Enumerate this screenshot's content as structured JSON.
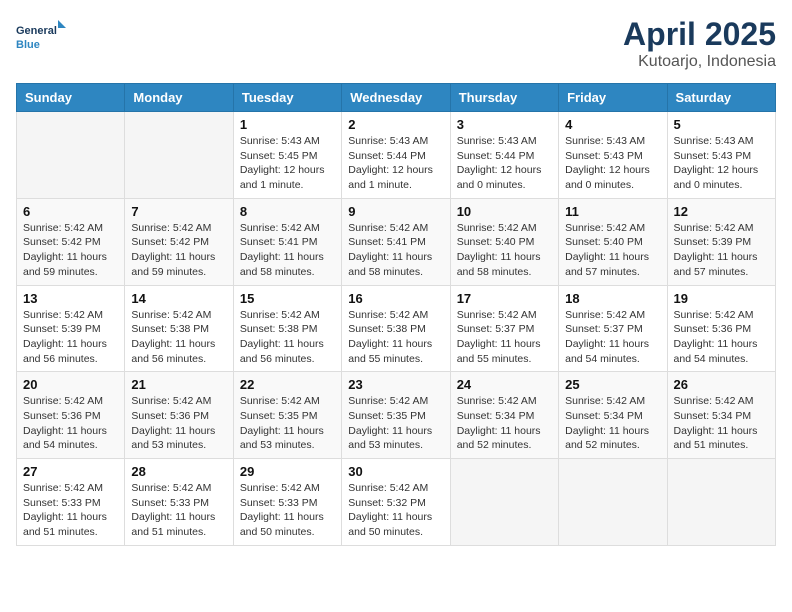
{
  "header": {
    "logo_line1": "General",
    "logo_line2": "Blue",
    "title": "April 2025",
    "subtitle": "Kutoarjo, Indonesia"
  },
  "weekdays": [
    "Sunday",
    "Monday",
    "Tuesday",
    "Wednesday",
    "Thursday",
    "Friday",
    "Saturday"
  ],
  "weeks": [
    [
      {
        "day": "",
        "info": ""
      },
      {
        "day": "",
        "info": ""
      },
      {
        "day": "1",
        "info": "Sunrise: 5:43 AM\nSunset: 5:45 PM\nDaylight: 12 hours and 1 minute."
      },
      {
        "day": "2",
        "info": "Sunrise: 5:43 AM\nSunset: 5:44 PM\nDaylight: 12 hours and 1 minute."
      },
      {
        "day": "3",
        "info": "Sunrise: 5:43 AM\nSunset: 5:44 PM\nDaylight: 12 hours and 0 minutes."
      },
      {
        "day": "4",
        "info": "Sunrise: 5:43 AM\nSunset: 5:43 PM\nDaylight: 12 hours and 0 minutes."
      },
      {
        "day": "5",
        "info": "Sunrise: 5:43 AM\nSunset: 5:43 PM\nDaylight: 12 hours and 0 minutes."
      }
    ],
    [
      {
        "day": "6",
        "info": "Sunrise: 5:42 AM\nSunset: 5:42 PM\nDaylight: 11 hours and 59 minutes."
      },
      {
        "day": "7",
        "info": "Sunrise: 5:42 AM\nSunset: 5:42 PM\nDaylight: 11 hours and 59 minutes."
      },
      {
        "day": "8",
        "info": "Sunrise: 5:42 AM\nSunset: 5:41 PM\nDaylight: 11 hours and 58 minutes."
      },
      {
        "day": "9",
        "info": "Sunrise: 5:42 AM\nSunset: 5:41 PM\nDaylight: 11 hours and 58 minutes."
      },
      {
        "day": "10",
        "info": "Sunrise: 5:42 AM\nSunset: 5:40 PM\nDaylight: 11 hours and 58 minutes."
      },
      {
        "day": "11",
        "info": "Sunrise: 5:42 AM\nSunset: 5:40 PM\nDaylight: 11 hours and 57 minutes."
      },
      {
        "day": "12",
        "info": "Sunrise: 5:42 AM\nSunset: 5:39 PM\nDaylight: 11 hours and 57 minutes."
      }
    ],
    [
      {
        "day": "13",
        "info": "Sunrise: 5:42 AM\nSunset: 5:39 PM\nDaylight: 11 hours and 56 minutes."
      },
      {
        "day": "14",
        "info": "Sunrise: 5:42 AM\nSunset: 5:38 PM\nDaylight: 11 hours and 56 minutes."
      },
      {
        "day": "15",
        "info": "Sunrise: 5:42 AM\nSunset: 5:38 PM\nDaylight: 11 hours and 56 minutes."
      },
      {
        "day": "16",
        "info": "Sunrise: 5:42 AM\nSunset: 5:38 PM\nDaylight: 11 hours and 55 minutes."
      },
      {
        "day": "17",
        "info": "Sunrise: 5:42 AM\nSunset: 5:37 PM\nDaylight: 11 hours and 55 minutes."
      },
      {
        "day": "18",
        "info": "Sunrise: 5:42 AM\nSunset: 5:37 PM\nDaylight: 11 hours and 54 minutes."
      },
      {
        "day": "19",
        "info": "Sunrise: 5:42 AM\nSunset: 5:36 PM\nDaylight: 11 hours and 54 minutes."
      }
    ],
    [
      {
        "day": "20",
        "info": "Sunrise: 5:42 AM\nSunset: 5:36 PM\nDaylight: 11 hours and 54 minutes."
      },
      {
        "day": "21",
        "info": "Sunrise: 5:42 AM\nSunset: 5:36 PM\nDaylight: 11 hours and 53 minutes."
      },
      {
        "day": "22",
        "info": "Sunrise: 5:42 AM\nSunset: 5:35 PM\nDaylight: 11 hours and 53 minutes."
      },
      {
        "day": "23",
        "info": "Sunrise: 5:42 AM\nSunset: 5:35 PM\nDaylight: 11 hours and 53 minutes."
      },
      {
        "day": "24",
        "info": "Sunrise: 5:42 AM\nSunset: 5:34 PM\nDaylight: 11 hours and 52 minutes."
      },
      {
        "day": "25",
        "info": "Sunrise: 5:42 AM\nSunset: 5:34 PM\nDaylight: 11 hours and 52 minutes."
      },
      {
        "day": "26",
        "info": "Sunrise: 5:42 AM\nSunset: 5:34 PM\nDaylight: 11 hours and 51 minutes."
      }
    ],
    [
      {
        "day": "27",
        "info": "Sunrise: 5:42 AM\nSunset: 5:33 PM\nDaylight: 11 hours and 51 minutes."
      },
      {
        "day": "28",
        "info": "Sunrise: 5:42 AM\nSunset: 5:33 PM\nDaylight: 11 hours and 51 minutes."
      },
      {
        "day": "29",
        "info": "Sunrise: 5:42 AM\nSunset: 5:33 PM\nDaylight: 11 hours and 50 minutes."
      },
      {
        "day": "30",
        "info": "Sunrise: 5:42 AM\nSunset: 5:32 PM\nDaylight: 11 hours and 50 minutes."
      },
      {
        "day": "",
        "info": ""
      },
      {
        "day": "",
        "info": ""
      },
      {
        "day": "",
        "info": ""
      }
    ]
  ]
}
